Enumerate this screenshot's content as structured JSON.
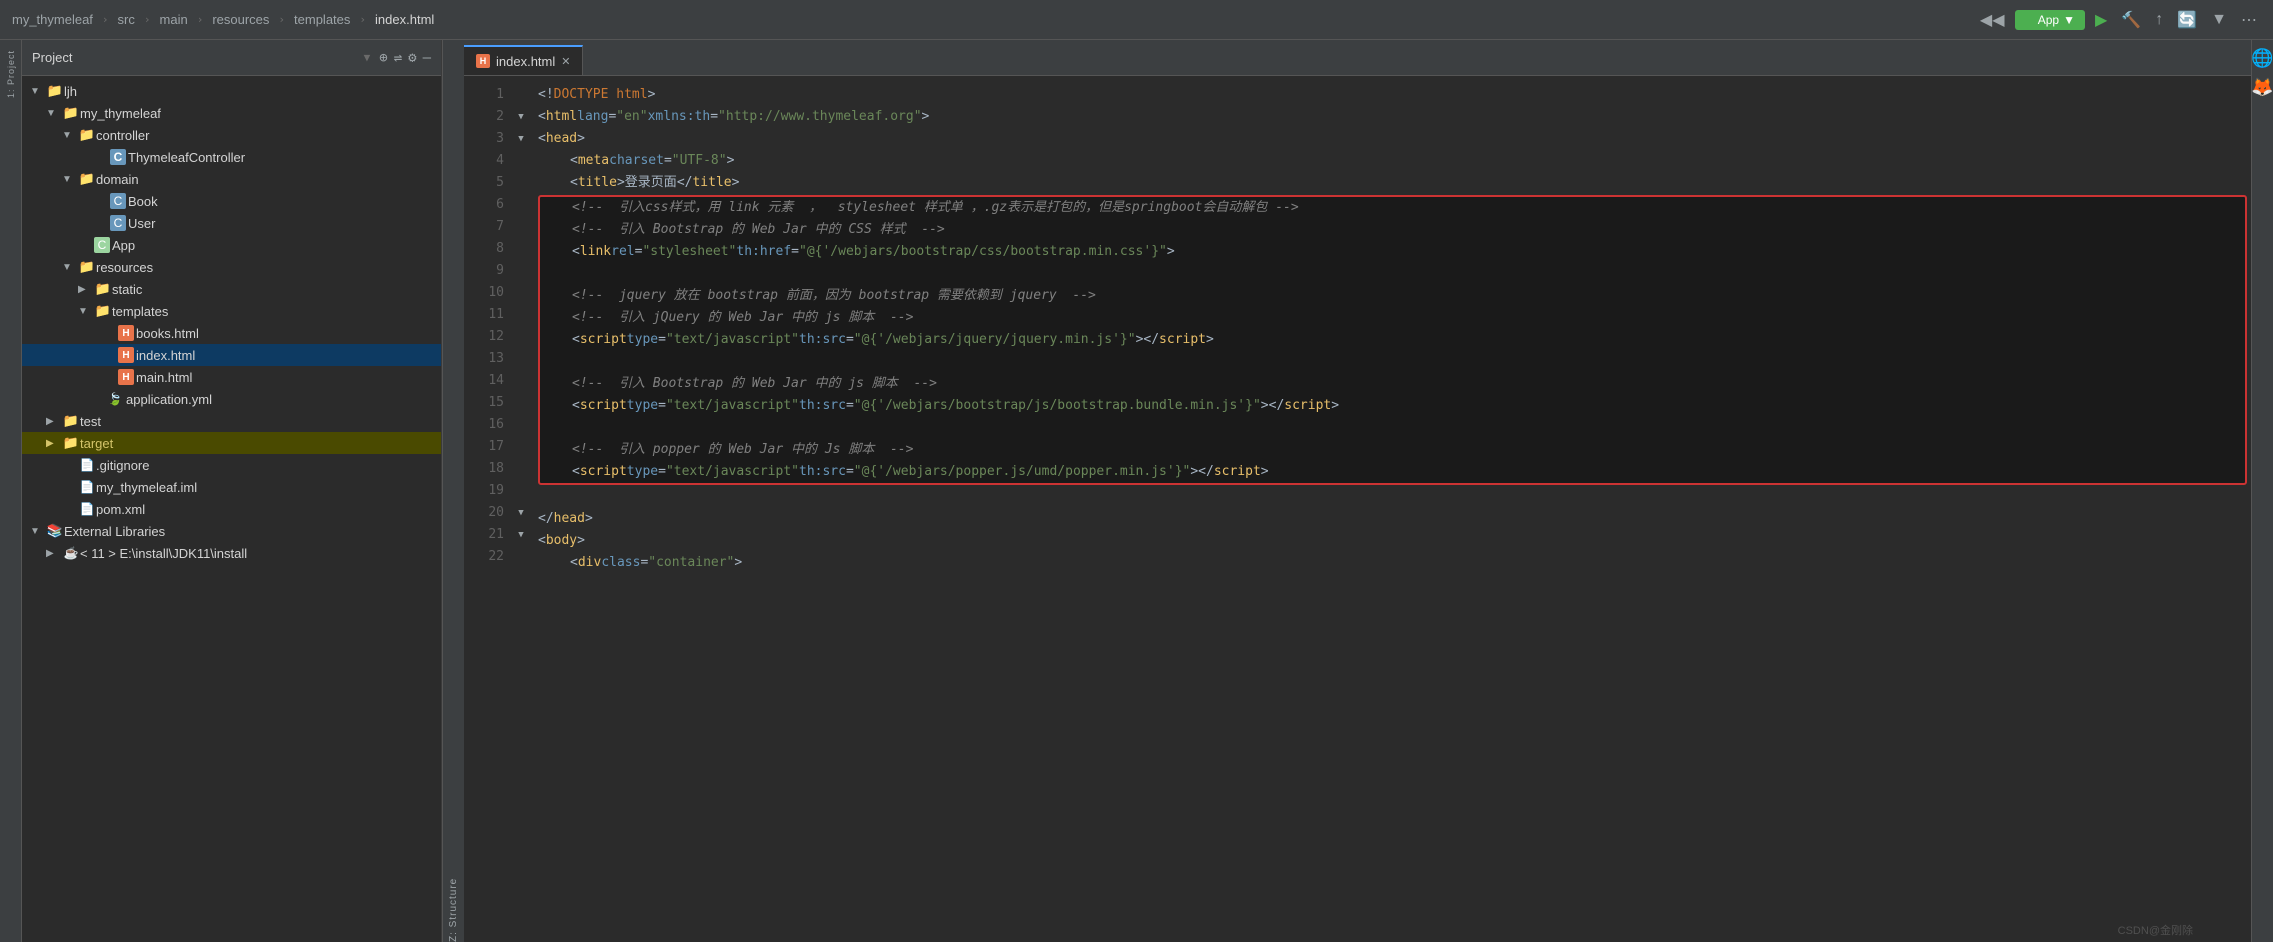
{
  "topbar": {
    "breadcrumbs": [
      {
        "label": "my_thymeleaf",
        "type": "project"
      },
      {
        "label": "src",
        "type": "dir"
      },
      {
        "label": "main",
        "type": "dir"
      },
      {
        "label": "resources",
        "type": "dir"
      },
      {
        "label": "templates",
        "type": "dir"
      },
      {
        "label": "index.html",
        "type": "file"
      }
    ],
    "run_dropdown": "App",
    "icons": [
      "▶",
      "🔨",
      "↑",
      "🔄",
      "▼"
    ]
  },
  "panel": {
    "title": "Project",
    "icons": [
      "⊕",
      "⇌",
      "⚙",
      "—"
    ]
  },
  "filetree": [
    {
      "id": "ljh",
      "label": "ljh",
      "type": "folder",
      "indent": 1,
      "arrow": "▼",
      "icon": "📁"
    },
    {
      "id": "my_thymeleaf",
      "label": "my_thymeleaf",
      "type": "folder",
      "indent": 2,
      "arrow": "▼",
      "icon": "📁"
    },
    {
      "id": "controller",
      "label": "controller",
      "type": "folder",
      "indent": 3,
      "arrow": "▼",
      "icon": "📁"
    },
    {
      "id": "ThymeleafController",
      "label": "ThymeleafController",
      "type": "java-class",
      "indent": 5,
      "arrow": "",
      "icon": "C"
    },
    {
      "id": "domain",
      "label": "domain",
      "type": "folder",
      "indent": 3,
      "arrow": "▼",
      "icon": "📁"
    },
    {
      "id": "Book",
      "label": "Book",
      "type": "java-class",
      "indent": 5,
      "arrow": "",
      "icon": "C"
    },
    {
      "id": "User",
      "label": "User",
      "type": "java-class",
      "indent": 5,
      "arrow": "",
      "icon": "C"
    },
    {
      "id": "App",
      "label": "App",
      "type": "app-class",
      "indent": 4,
      "arrow": "",
      "icon": "C"
    },
    {
      "id": "resources",
      "label": "resources",
      "type": "folder",
      "indent": 3,
      "arrow": "▼",
      "icon": "📁"
    },
    {
      "id": "static",
      "label": "static",
      "type": "folder",
      "indent": 4,
      "arrow": "▶",
      "icon": "📁"
    },
    {
      "id": "templates",
      "label": "templates",
      "type": "folder",
      "indent": 4,
      "arrow": "▼",
      "icon": "📁"
    },
    {
      "id": "books.html",
      "label": "books.html",
      "type": "html",
      "indent": 6,
      "arrow": "",
      "icon": "H"
    },
    {
      "id": "index.html",
      "label": "index.html",
      "type": "html",
      "indent": 6,
      "arrow": "",
      "icon": "H",
      "selected": true
    },
    {
      "id": "main.html",
      "label": "main.html",
      "type": "html",
      "indent": 6,
      "arrow": "",
      "icon": "H"
    },
    {
      "id": "application.yml",
      "label": "application.yml",
      "type": "yaml",
      "indent": 5,
      "arrow": "",
      "icon": "Y"
    },
    {
      "id": "test",
      "label": "test",
      "type": "folder",
      "indent": 2,
      "arrow": "▶",
      "icon": "📁"
    },
    {
      "id": "target",
      "label": "target",
      "type": "folder-target",
      "indent": 2,
      "arrow": "▶",
      "icon": "📁"
    },
    {
      "id": ".gitignore",
      "label": ".gitignore",
      "type": "git",
      "indent": 2,
      "arrow": "",
      "icon": ""
    },
    {
      "id": "my_thymeleaf.iml",
      "label": "my_thymeleaf.iml",
      "type": "iml",
      "indent": 2,
      "arrow": "",
      "icon": ""
    },
    {
      "id": "pom.xml",
      "label": "pom.xml",
      "type": "xml",
      "indent": 2,
      "arrow": "",
      "icon": ""
    },
    {
      "id": "external_libraries",
      "label": "External Libraries",
      "type": "lib",
      "indent": 1,
      "arrow": "▼",
      "icon": "📚"
    },
    {
      "id": "jdk11",
      "label": "< 11 > E:\\install\\JDK11\\install",
      "type": "jdk",
      "indent": 2,
      "arrow": "▶",
      "icon": ""
    }
  ],
  "editor": {
    "tab_label": "index.html",
    "tab_icon": "H"
  },
  "code_lines": [
    {
      "num": 1,
      "fold": false,
      "content_html": "<span class='punct'>&lt;!</span><span class='doctype'>DOCTYPE html</span><span class='punct'>&gt;</span>"
    },
    {
      "num": 2,
      "fold": true,
      "content_html": "<span class='punct'>&lt;</span><span class='tag'>html</span> <span class='attr'>lang</span><span class='punct'>=</span><span class='val'>\"en\"</span> <span class='attr'>xmlns:th</span><span class='punct'>=</span><span class='val'>\"http://www.thymeleaf.org\"</span><span class='punct'>&gt;</span>"
    },
    {
      "num": 3,
      "fold": true,
      "content_html": "<span class='punct'>&lt;</span><span class='tag'>head</span><span class='punct'>&gt;</span>"
    },
    {
      "num": 4,
      "fold": false,
      "content_html": "    <span class='punct'>&lt;</span><span class='tag'>meta</span> <span class='attr'>charset</span><span class='punct'>=</span><span class='val'>\"UTF-8\"</span><span class='punct'>&gt;</span>"
    },
    {
      "num": 5,
      "fold": false,
      "content_html": "    <span class='punct'>&lt;</span><span class='tag'>title</span><span class='punct'>&gt;</span><span class='zh'>登录页面</span><span class='punct'>&lt;/</span><span class='tag'>title</span><span class='punct'>&gt;</span>"
    },
    {
      "num": 6,
      "fold": false,
      "content_html": "    <span class='comment'>&lt;!--  引入css样式，用 link 元素  ，  stylesheet 样式单 ，.gz表示是打包的，但是springboot会自动解包 --&gt;</span>",
      "highlighted": true
    },
    {
      "num": 7,
      "fold": false,
      "content_html": "    <span class='comment'>&lt;!--  引入 Bootstrap 的 Web Jar 中的 CSS 样式  --&gt;</span>",
      "highlighted": true
    },
    {
      "num": 8,
      "fold": false,
      "content_html": "    <span class='punct'>&lt;</span><span class='tag'>link</span> <span class='attr'>rel</span><span class='punct'>=</span><span class='val'>\"stylesheet\"</span> <span class='attr'>th:href</span><span class='punct'>=</span><span class='val'>\"@{'/webjars/bootstrap/css/bootstrap.min.css'}\"</span><span class='punct'>&gt;</span>",
      "highlighted": true
    },
    {
      "num": 9,
      "fold": false,
      "content_html": "",
      "highlighted": true
    },
    {
      "num": 10,
      "fold": false,
      "content_html": "    <span class='comment'>&lt;!--  jquery 放在 bootstrap 前面，因为 bootstrap 需要依赖到 jquery  --&gt;</span>",
      "highlighted": true
    },
    {
      "num": 11,
      "fold": false,
      "content_html": "    <span class='comment'>&lt;!--  引入 jQuery 的 Web Jar 中的 js 脚本  --&gt;</span>",
      "highlighted": true
    },
    {
      "num": 12,
      "fold": false,
      "content_html": "    <span class='punct'>&lt;</span><span class='tag'>script</span> <span class='attr'>type</span><span class='punct'>=</span><span class='val'>\"text/javascript\"</span> <span class='attr'>th:src</span><span class='punct'>=</span><span class='val'>\"@{'/webjars/jquery/jquery.min.js'}\"</span><span class='punct'>&gt;&lt;/</span><span class='tag'>script</span><span class='punct'>&gt;</span>",
      "highlighted": true
    },
    {
      "num": 13,
      "fold": false,
      "content_html": "",
      "highlighted": true
    },
    {
      "num": 14,
      "fold": false,
      "content_html": "    <span class='comment'>&lt;!--  引入 Bootstrap 的 Web Jar 中的 js 脚本  --&gt;</span>",
      "highlighted": true
    },
    {
      "num": 15,
      "fold": false,
      "content_html": "    <span class='punct'>&lt;</span><span class='tag'>script</span> <span class='attr'>type</span><span class='punct'>=</span><span class='val'>\"text/javascript\"</span> <span class='attr'>th:src</span><span class='punct'>=</span><span class='val'>\"@{'/webjars/bootstrap/js/bootstrap.bundle.min.js'}\"</span><span class='punct'>&gt;&lt;/</span><span class='tag'>script</span><span class='punct'>&gt;</span>",
      "highlighted": true
    },
    {
      "num": 16,
      "fold": false,
      "content_html": "",
      "highlighted": true
    },
    {
      "num": 17,
      "fold": false,
      "content_html": "    <span class='comment'>&lt;!--  引入 popper 的 Web Jar 中的 Js 脚本  --&gt;</span>",
      "highlighted": true
    },
    {
      "num": 18,
      "fold": false,
      "content_html": "    <span class='punct'>&lt;</span><span class='tag'>script</span> <span class='attr'>type</span><span class='punct'>=</span><span class='val'>\"text/javascript\"</span> <span class='attr'>th:src</span><span class='punct'>=</span><span class='val'>\"@{'/webjars/popper.js/umd/popper.min.js'}\"</span><span class='punct'>&gt;&lt;/</span><span class='tag'>script</span><span class='punct'>&gt;</span>",
      "highlighted": true
    },
    {
      "num": 19,
      "fold": false,
      "content_html": ""
    },
    {
      "num": 20,
      "fold": true,
      "content_html": "<span class='punct'>&lt;/</span><span class='tag'>head</span><span class='punct'>&gt;</span>"
    },
    {
      "num": 21,
      "fold": true,
      "content_html": "<span class='punct'>&lt;</span><span class='tag'>body</span><span class='punct'>&gt;</span>"
    },
    {
      "num": 22,
      "fold": false,
      "content_html": "    <span class='punct'>&lt;</span><span class='tag'>div</span> <span class='attr'>class</span><span class='punct'>=</span><span class='val'>\"container\"</span><span class='punct'>&gt;</span>"
    }
  ],
  "watermark": "CSDN@金刚除",
  "structure_label": "Z: Structure",
  "project_label": "1: Project"
}
